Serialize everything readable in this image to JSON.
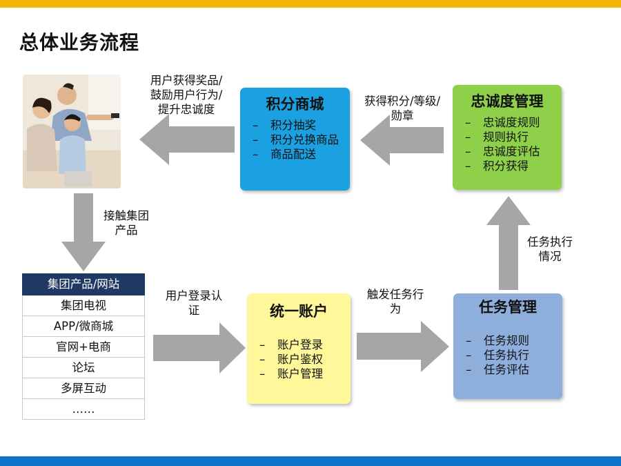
{
  "title": "总体业务流程",
  "colors": {
    "top_bar": "#f2b705",
    "bottom_bar": "#0e73c8",
    "mall": "#1ba1e2",
    "loyalty": "#8ed04a",
    "account": "#fff89a",
    "task": "#8eaedc",
    "arrow": "#a6a6a6",
    "list_header": "#1f3864"
  },
  "family_image": {
    "description_icon": "family-photo"
  },
  "mall": {
    "title": "积分商城",
    "items": [
      "积分抽奖",
      "积分兑换商品",
      "商品配送"
    ]
  },
  "loyalty": {
    "title": "忠诚度管理",
    "items": [
      "忠诚度规则",
      "规则执行",
      "忠诚度评估",
      "积分获得"
    ]
  },
  "account": {
    "title": "统一账户",
    "items": [
      "账户登录",
      "账户鉴权",
      "账户管理"
    ]
  },
  "task": {
    "title": "任务管理",
    "items": [
      "任务规则",
      "任务执行",
      "任务评估"
    ]
  },
  "products": {
    "header": "集团产品/网站",
    "items": [
      "集团电视",
      "APP/微商城",
      "官网+电商",
      "论坛",
      "多屏互动",
      "……"
    ]
  },
  "labels": {
    "reward": [
      "用户获得奖品/",
      "鼓励用户行为/",
      "提升忠诚度"
    ],
    "earn": [
      "获得积分/等级/",
      "勋章"
    ],
    "contact": [
      "接触集团",
      "产品"
    ],
    "login": [
      "用户登录认",
      "证"
    ],
    "trigger": [
      "触发任务行",
      "为"
    ],
    "task_exec": [
      "任务执行",
      "情况"
    ]
  },
  "dash": "–"
}
